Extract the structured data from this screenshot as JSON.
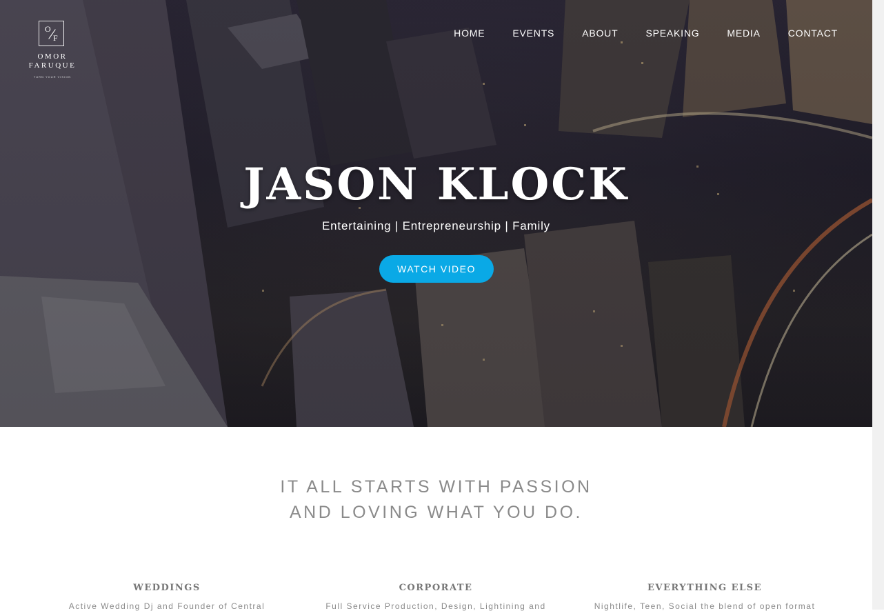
{
  "logo": {
    "mark_top": "O",
    "mark_bottom": "F",
    "name_line1": "OMOR",
    "name_line2": "FARUQUE",
    "tagline": "TURN YOUR VISION"
  },
  "nav": {
    "items": [
      "HOME",
      "EVENTS",
      "ABOUT",
      "SPEAKING",
      "MEDIA",
      "CONTACT"
    ]
  },
  "hero": {
    "title": "JASON KLOCK",
    "subtitle": "Entertaining | Entrepreneurship | Family",
    "button_label": "WATCH VIDEO",
    "button_color": "#0aa9e6"
  },
  "intro": {
    "line1": "IT ALL STARTS WITH PASSION",
    "line2": "AND LOVING WHAT YOU DO."
  },
  "services": [
    {
      "title": "WEDDINGS",
      "text": "Active Wedding Dj and Founder of Central"
    },
    {
      "title": "CORPORATE",
      "text": "Full Service Production, Design, Lightining and"
    },
    {
      "title": "EVERYTHING ELSE",
      "text": "Nightlife, Teen, Social the blend of open format"
    }
  ]
}
